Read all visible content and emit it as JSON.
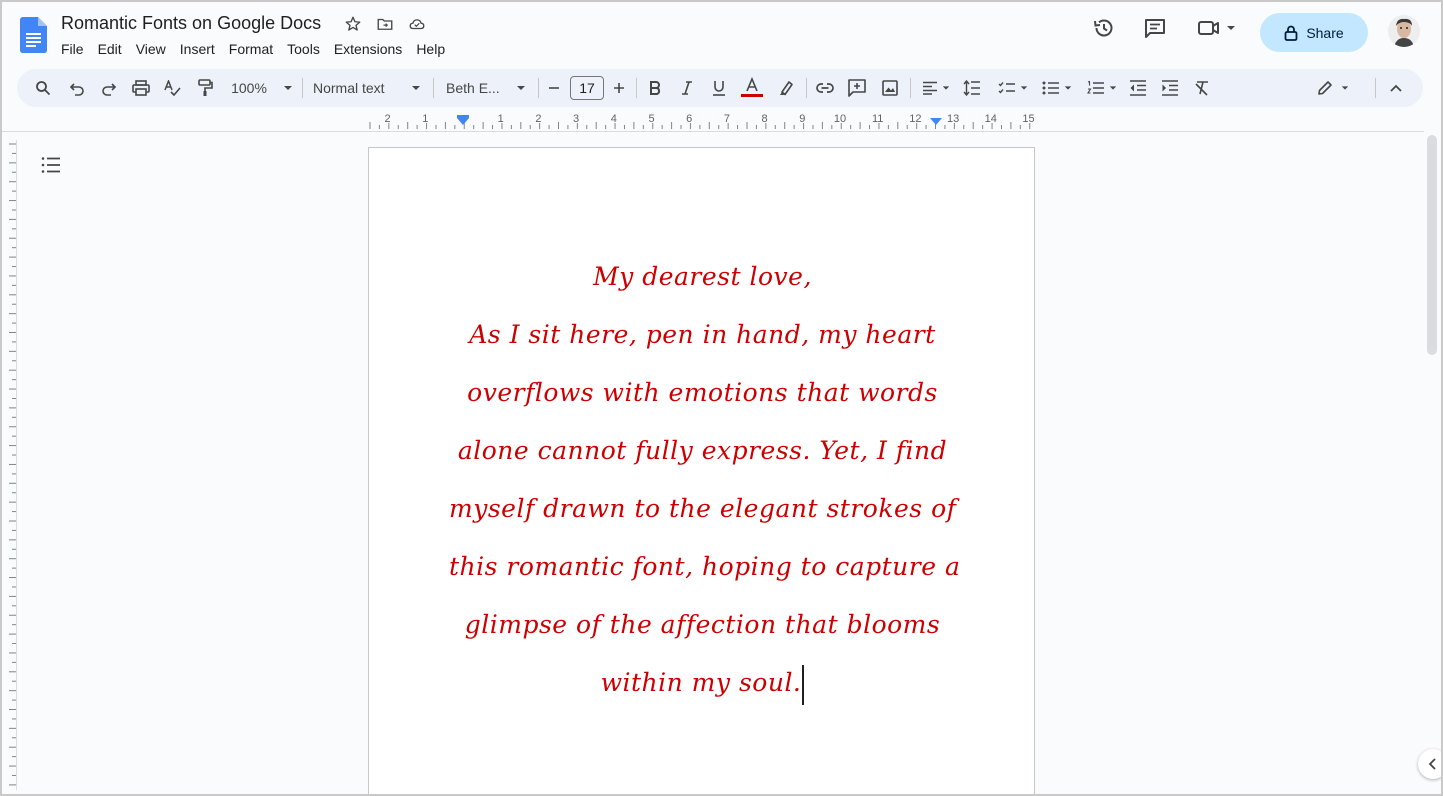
{
  "app": {
    "title": "Romantic Fonts on Google Docs",
    "menu": [
      "File",
      "Edit",
      "View",
      "Insert",
      "Format",
      "Tools",
      "Extensions",
      "Help"
    ],
    "share_label": "Share"
  },
  "toolbar": {
    "zoom": "100%",
    "style": "Normal text",
    "font": "Beth E...",
    "font_size": "17",
    "text_color": "#cc0000"
  },
  "ruler": {
    "labels": [
      "2",
      "1",
      "1",
      "2",
      "3",
      "4",
      "5",
      "6",
      "7",
      "8",
      "9",
      "10",
      "11",
      "12",
      "13",
      "14",
      "15"
    ]
  },
  "document": {
    "lines": [
      "My dearest love,",
      "As I sit here, pen in hand, my heart",
      "overflows with emotions that words",
      "alone cannot fully express. Yet, I find",
      "myself drawn to the elegant strokes of",
      "this romantic font, hoping to capture a",
      "glimpse of the affection that blooms",
      "within my soul."
    ],
    "text_color": "#cc0000"
  },
  "colors": {
    "accent": "#1a73e8",
    "share_bg": "#c2e7ff",
    "toolbar_bg": "#edf2fa"
  }
}
